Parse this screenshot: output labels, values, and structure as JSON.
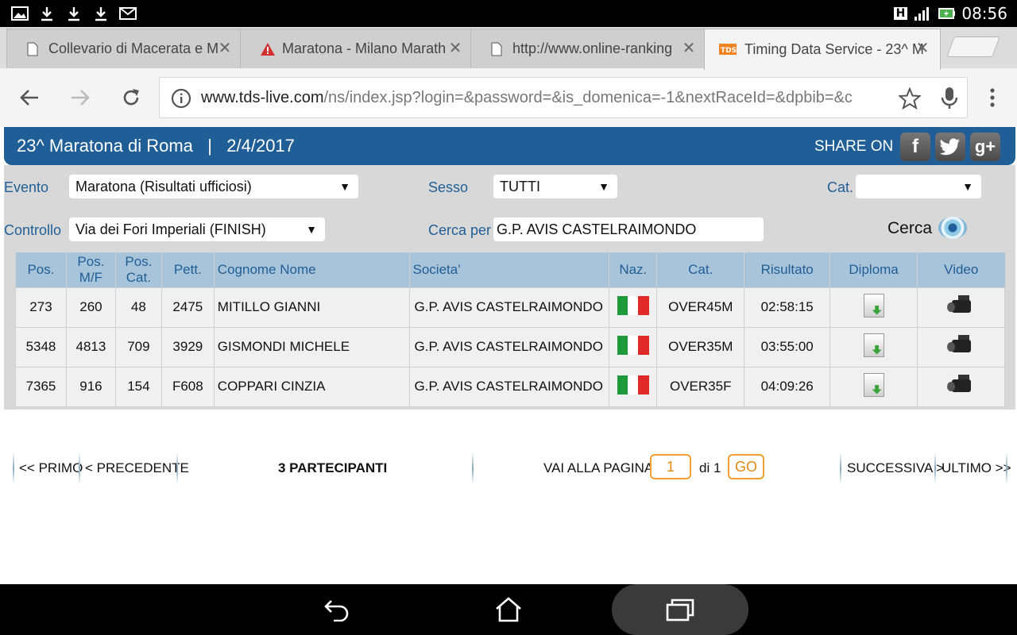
{
  "status": {
    "time": "08:56",
    "network": "H"
  },
  "tabs": [
    {
      "title": "Collevario di Macerata e M"
    },
    {
      "title": "Maratona - Milano Marath"
    },
    {
      "title": "http://www.online-ranking"
    },
    {
      "title": "Timing Data Service - 23^ M"
    }
  ],
  "url": {
    "host": "www.tds-live.com",
    "path": "/ns/index.jsp?login=&password=&is_domenica=-1&nextRaceId=&dpbib=&c"
  },
  "header": {
    "title": "23^ Maratona di Roma   |   2/4/2017",
    "share": "SHARE ON",
    "social": {
      "facebook": "f",
      "twitter": "t",
      "gplus": "g+"
    },
    "colors": {
      "band": "#1f5e96",
      "label": "#1f5e96",
      "accent": "#f0a030"
    }
  },
  "filters": {
    "evento_label": "Evento",
    "evento_value": "Maratona (Risultati ufficiosi)",
    "sesso_label": "Sesso",
    "sesso_value": "TUTTI",
    "cat_label": "Cat.",
    "cat_value": "",
    "controllo_label": "Controllo",
    "controllo_value": "Via dei Fori Imperiali (FINISH)",
    "cerca_per_label": "Cerca per",
    "cerca_per_value": "G.P. AVIS CASTELRAIMONDO",
    "cerca_button": "Cerca"
  },
  "table": {
    "headers": [
      "Pos.",
      "Pos. M/F",
      "Pos. Cat.",
      "Pett.",
      "Cognome Nome",
      "Societa'",
      "Naz.",
      "Cat.",
      "Risultato",
      "Diploma",
      "Video"
    ],
    "rows": [
      {
        "pos": "273",
        "posmf": "260",
        "poscat": "48",
        "pett": "2475",
        "name": "MITILLO GIANNI",
        "club": "G.P. AVIS CASTELRAIMONDO",
        "naz": "italy-flag",
        "cat": "OVER45M",
        "result": "02:58:15"
      },
      {
        "pos": "5348",
        "posmf": "4813",
        "poscat": "709",
        "pett": "3929",
        "name": "GISMONDI MICHELE",
        "club": "G.P. AVIS CASTELRAIMONDO",
        "naz": "italy-flag",
        "cat": "OVER35M",
        "result": "03:55:00"
      },
      {
        "pos": "7365",
        "posmf": "916",
        "poscat": "154",
        "pett": "F608",
        "name": "COPPARI CINZIA",
        "club": "G.P. AVIS CASTELRAIMONDO",
        "naz": "italy-flag",
        "cat": "OVER35F",
        "result": "04:09:26"
      }
    ]
  },
  "pager": {
    "first": "<< PRIMO",
    "prev": "< PRECEDENTE",
    "count": "3 PARTECIPANTI",
    "goto_label": "VAI ALLA PAGINA",
    "page": "1",
    "of": "di 1",
    "go": "GO",
    "next": "SUCCESSIVA >",
    "last": "ULTIMO >>"
  }
}
